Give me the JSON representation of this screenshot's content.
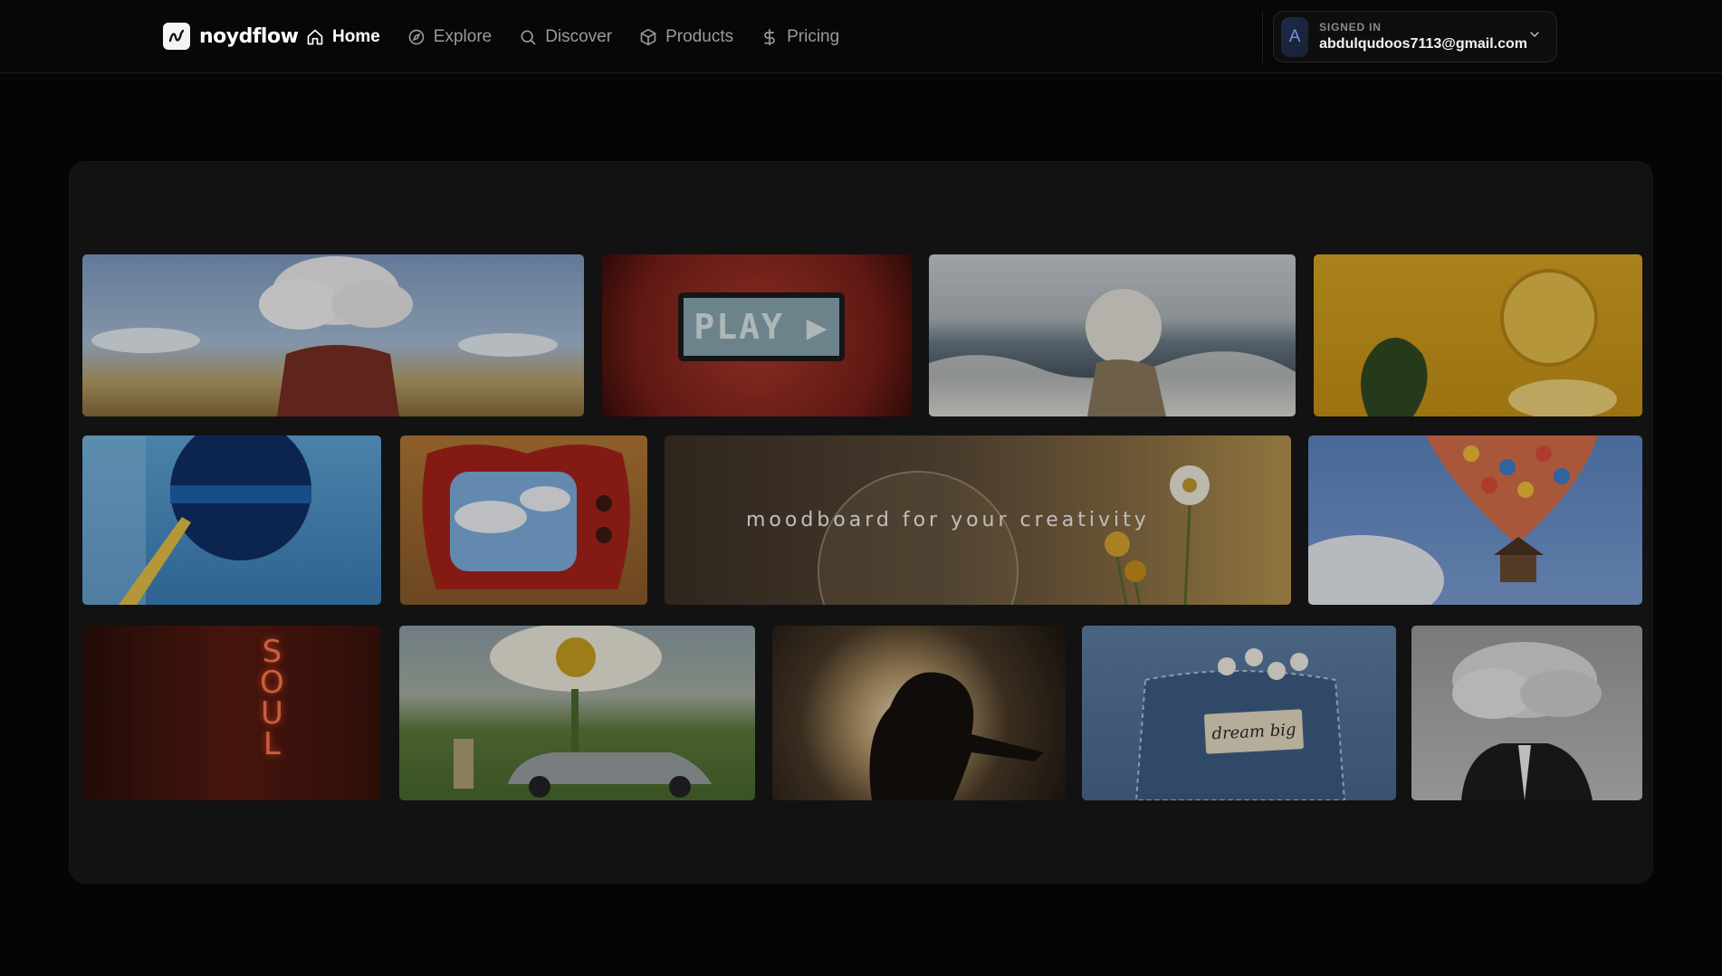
{
  "brand": {
    "name": "noydflow",
    "logo_icon": "wave-icon"
  },
  "nav": [
    {
      "label": "Home",
      "icon": "home-icon",
      "active": true
    },
    {
      "label": "Explore",
      "icon": "compass-icon",
      "active": false
    },
    {
      "label": "Discover",
      "icon": "search-icon",
      "active": false
    },
    {
      "label": "Products",
      "icon": "box-icon",
      "active": false
    },
    {
      "label": "Pricing",
      "icon": "dollar-icon",
      "active": false
    }
  ],
  "account": {
    "status_label": "SIGNED IN",
    "email": "abdulqudoos7113@gmail.com",
    "avatar_initial": "A",
    "menu_icon": "chevron-down-icon"
  },
  "hero": {
    "tagline": "moodboard for your creativity",
    "tiles": {
      "play_text": "PLAY ▶",
      "soul_letters": [
        "S",
        "O",
        "U",
        "L"
      ],
      "patch_text": "dream big"
    }
  },
  "colors": {
    "background": "#050505",
    "card": "#121212",
    "accent_avatar": "#6f93e8",
    "nav_active": "#ffffff",
    "nav_inactive": "#9a9a9a"
  }
}
